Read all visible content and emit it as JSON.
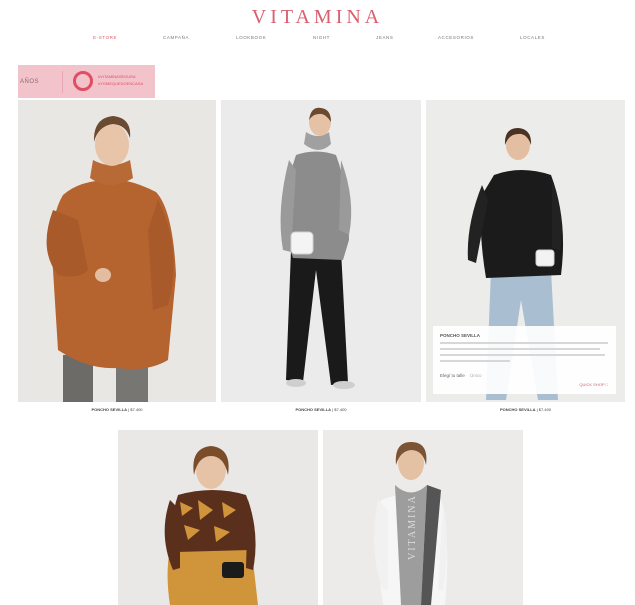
{
  "header": {
    "logo": "VITAMINA"
  },
  "nav": {
    "items": [
      "E-STORE",
      "CAMPAÑA",
      "LOOKBOOK",
      "NIGHT",
      "JEANS",
      "ACCESORIOS",
      "LOCALES"
    ],
    "active": "E-STORE"
  },
  "promo": {
    "left_text": "AÑOS",
    "line1": "#VITAMINASEGURA",
    "line2": "#YOMEQUEDOENCASA",
    "colors": {
      "background": "#f2c3cb",
      "ring": "#e14d63"
    }
  },
  "products": [
    {
      "name": "PONCHO SEVILLA",
      "price": "$7.400"
    },
    {
      "name": "PONCHO SEVILLA",
      "price": "$7.400"
    },
    {
      "name": "PONCHO SEVILLA",
      "price": "$7.400"
    }
  ],
  "quick_view": {
    "title": "PONCHO SEVILLA",
    "size_label": "Elegí tu talle",
    "size_value": "Único",
    "button": "QUICK SHOP"
  },
  "colors": {
    "brand": "#d9606e"
  }
}
